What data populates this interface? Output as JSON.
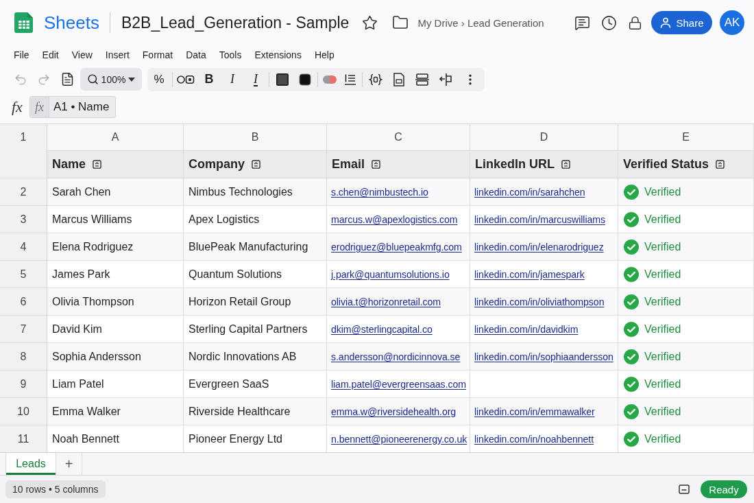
{
  "top_bar": {
    "app_name": "Sheets",
    "document_title": "B2B_Lead_Generation - Sample",
    "breadcrumb": "My Drive › Lead Generation",
    "share_button": "Share",
    "avatar_initials": "AK"
  },
  "menu": [
    "File",
    "Edit",
    "View",
    "Insert",
    "Format",
    "Data",
    "Tools",
    "Extensions",
    "Help"
  ],
  "toolbar": {
    "undo": {
      "disabled": true
    },
    "redo": {
      "disabled": true
    },
    "zoom": "100%",
    "percent": "%",
    "bold": "B",
    "italic": "I",
    "underline": "I"
  },
  "formula_bar": {
    "label": "fx",
    "chip": "fx",
    "value": "A1 • Name"
  },
  "sheet": {
    "column_letters": [
      "A",
      "B",
      "C",
      "D",
      "E"
    ],
    "header_row_number": "1",
    "headers": [
      "Name",
      "Company",
      "Email",
      "LinkedIn URL",
      "Verified Status"
    ],
    "rows": [
      {
        "number": "2",
        "name": "Sarah Chen",
        "company": "Nimbus Technologies",
        "email": "s.chen@nimbustech.io",
        "linkedin": "linkedin.com/in/sarahchen",
        "status": {
          "label": "Verified",
          "kind": "verified"
        }
      },
      {
        "number": "3",
        "name": "Marcus Williams",
        "company": "Apex Logistics",
        "email": "marcus.w@apexlogistics.com",
        "linkedin": "linkedin.com/in/marcuswilliams",
        "status": {
          "label": "Verified",
          "kind": "verified"
        }
      },
      {
        "number": "4",
        "name": "Elena Rodriguez",
        "company": "BluePeak Manufacturing",
        "email": "erodriguez@bluepeakmfg.com",
        "linkedin": "linkedin.com/in/elenarodriguez",
        "status": {
          "label": "Verified",
          "kind": "verified"
        }
      },
      {
        "number": "5",
        "name": "James Park",
        "company": "Quantum Solutions",
        "email": "j.park@quantumsolutions.io",
        "linkedin": "linkedin.com/in/jamespark",
        "status": {
          "label": "Verified",
          "kind": "verified"
        }
      },
      {
        "number": "6",
        "name": "Olivia Thompson",
        "company": "Horizon Retail Group",
        "email": "olivia.t@horizonretail.com",
        "linkedin": "linkedin.com/in/oliviathompson",
        "status": {
          "label": "Verified",
          "kind": "verified"
        }
      },
      {
        "number": "7",
        "name": "David Kim",
        "company": "Sterling Capital Partners",
        "email": "dkim@sterlingcapital.co",
        "linkedin": "linkedin.com/in/davidkim",
        "status": {
          "label": "Verified",
          "kind": "verified"
        }
      },
      {
        "number": "8",
        "name": "Sophia Andersson",
        "company": "Nordic Innovations AB",
        "email": "s.andersson@nordicinnova.se",
        "linkedin": "linkedin.com/in/sophiaandersson",
        "status": {
          "label": "Verified",
          "kind": "verified"
        }
      },
      {
        "number": "9",
        "name": "Liam Patel",
        "company": "Evergreen SaaS",
        "email": "liam.patel@evergreensaas.com",
        "status": {
          "label": "Verified",
          "kind": "verified"
        }
      },
      {
        "number": "10",
        "name": "Emma Walker",
        "company": "Riverside Healthcare",
        "email": "emma.w@riversidehealth.org",
        "linkedin": "linkedin.com/in/emmawalker",
        "status": {
          "label": "Verified",
          "kind": "verified"
        }
      },
      {
        "number": "11",
        "name": "Noah Bennett",
        "company": "Pioneer Energy Ltd",
        "email": "n.bennett@pioneerenergy.co.uk",
        "linkedin": "linkedin.com/in/noahbennett",
        "status": {
          "label": "Verified",
          "kind": "verified"
        }
      }
    ]
  },
  "sheet_tabs": [
    {
      "label": "Leads",
      "selected": true
    }
  ],
  "add_sheet": "+",
  "status_bar": {
    "summary": "10 rows • 5 columns",
    "state": "Ready"
  }
}
